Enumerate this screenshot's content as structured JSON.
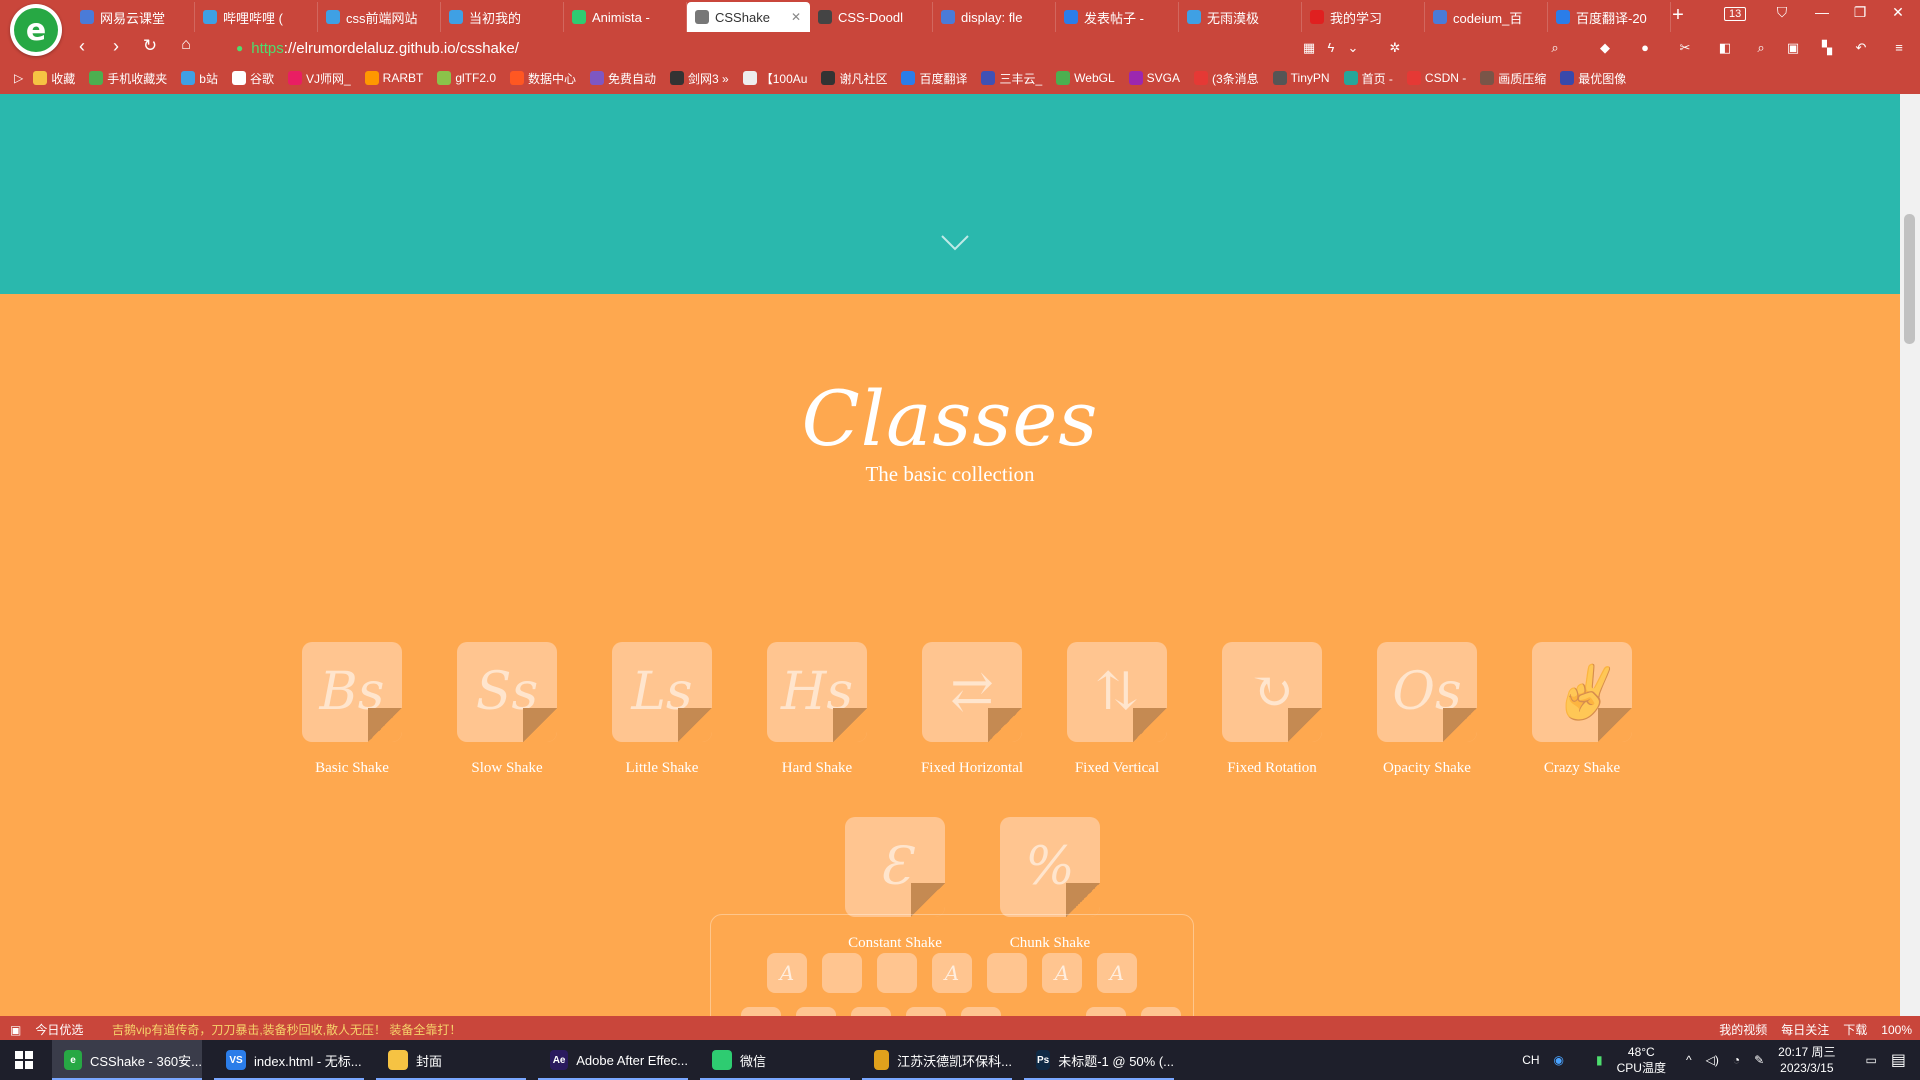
{
  "browser": {
    "tabs": [
      {
        "label": "网易云课堂",
        "icon_color": "#4a7bd8",
        "active": false
      },
      {
        "label": "哔哩哔哩 (",
        "icon_color": "#3fa0e4",
        "active": false
      },
      {
        "label": "css前端网站",
        "icon_color": "#3fa0e4",
        "active": false
      },
      {
        "label": "当初我的",
        "icon_color": "#3fa0e4",
        "active": false
      },
      {
        "label": "Animista - ",
        "icon_color": "#2ecc71",
        "active": false
      },
      {
        "label": "CSShake",
        "icon_color": "#777777",
        "active": true
      },
      {
        "label": "CSS-Doodl",
        "icon_color": "#444444",
        "active": false
      },
      {
        "label": "display: fle",
        "icon_color": "#4a7bd8",
        "active": false
      },
      {
        "label": "发表帖子 - ",
        "icon_color": "#2b7de9",
        "active": false
      },
      {
        "label": "无雨漠极",
        "icon_color": "#3fa0e4",
        "active": false
      },
      {
        "label": "我的学习",
        "icon_color": "#e02020",
        "active": false
      },
      {
        "label": "codeium_百",
        "icon_color": "#4a7bd8",
        "active": false
      },
      {
        "label": "百度翻译-20",
        "icon_color": "#2b7de9",
        "active": false
      }
    ],
    "tab_count": "13",
    "url_protocol": "https",
    "url_rest": "://elrumordelaluz.github.io/csshake/",
    "bookmarks": [
      {
        "label": "收藏",
        "color": "#f6c343"
      },
      {
        "label": "手机收藏夹",
        "color": "#4caf50"
      },
      {
        "label": "b站",
        "color": "#3fa0e4"
      },
      {
        "label": "谷歌",
        "color": "#ffffff"
      },
      {
        "label": "VJ师网_",
        "color": "#e91e63"
      },
      {
        "label": "RARBT",
        "color": "#ff9800"
      },
      {
        "label": "glTF2.0",
        "color": "#8bc34a"
      },
      {
        "label": "数据中心",
        "color": "#ff5722"
      },
      {
        "label": "免费自动",
        "color": "#7e57c2"
      },
      {
        "label": "剑网3 »",
        "color": "#333333"
      },
      {
        "label": "【100Au",
        "color": "#eeeeee"
      },
      {
        "label": "谢凡社区",
        "color": "#333333"
      },
      {
        "label": "百度翻译",
        "color": "#2b7de9"
      },
      {
        "label": "三丰云_",
        "color": "#3f51b5"
      },
      {
        "label": "WebGL",
        "color": "#4caf50"
      },
      {
        "label": "SVGA",
        "color": "#9c27b0"
      },
      {
        "label": "(3条消息",
        "color": "#e53935"
      },
      {
        "label": "TinyPN",
        "color": "#555555"
      },
      {
        "label": "首页 -",
        "color": "#26a69a"
      },
      {
        "label": "CSDN -",
        "color": "#e53935"
      },
      {
        "label": "画质压缩",
        "color": "#795548"
      },
      {
        "label": "最优图像",
        "color": "#3949ab"
      }
    ]
  },
  "page": {
    "hero_color": "#2ab8ad",
    "section_color": "#fea84f",
    "title": "Classes",
    "subtitle": "The basic collection",
    "cards": [
      {
        "name": "Basic Shake",
        "glyph": "Bs"
      },
      {
        "name": "Slow Shake",
        "glyph": "Ss"
      },
      {
        "name": "Little Shake",
        "glyph": "Ls"
      },
      {
        "name": "Hard Shake",
        "glyph": "Hs"
      },
      {
        "name": "Fixed Horizontal",
        "glyph": "⇄"
      },
      {
        "name": "Fixed Vertical",
        "glyph": "⇅"
      },
      {
        "name": "Fixed Rotation",
        "glyph": "↻"
      },
      {
        "name": "Opacity Shake",
        "glyph": "Os"
      },
      {
        "name": "Crazy Shake",
        "glyph": "✌"
      },
      {
        "name": "Constant Shake",
        "glyph": "Ɛ"
      },
      {
        "name": "Chunk Shake",
        "glyph": "%"
      }
    ],
    "keys": [
      "A",
      "",
      "",
      "A",
      "",
      "A",
      "A"
    ]
  },
  "statusbar": {
    "today": "今日优选",
    "news": "吉鹅vip有道传奇，刀刀暴击,装备秒回收,散人无压！ 装备全靠打！",
    "items": [
      "我的视频",
      "每日关注",
      "下载",
      "100%"
    ]
  },
  "taskbar": {
    "apps": [
      {
        "label": "CSShake - 360安...",
        "color": "#27a844",
        "icon": "e",
        "active": true
      },
      {
        "label": "index.html - 无标...",
        "color": "#2b7de9",
        "icon": "VS",
        "active": false
      },
      {
        "label": "封面",
        "color": "#f6c343",
        "icon": "",
        "active": false
      },
      {
        "label": "Adobe After Effec...",
        "color": "#2a1a5e",
        "icon": "Ae",
        "active": false
      },
      {
        "label": "微信",
        "color": "#2ecc71",
        "icon": "",
        "active": false
      },
      {
        "label": "江苏沃德凯环保科...",
        "color": "#e0a11c",
        "icon": "",
        "active": false
      },
      {
        "label": "未标题-1 @ 50% (...",
        "color": "#0f2a45",
        "icon": "Ps",
        "active": false
      }
    ],
    "ime": "CH",
    "temperature": "48°C",
    "temperature_label": "CPU温度",
    "time": "20:17 周三",
    "date": "2023/3/15"
  }
}
